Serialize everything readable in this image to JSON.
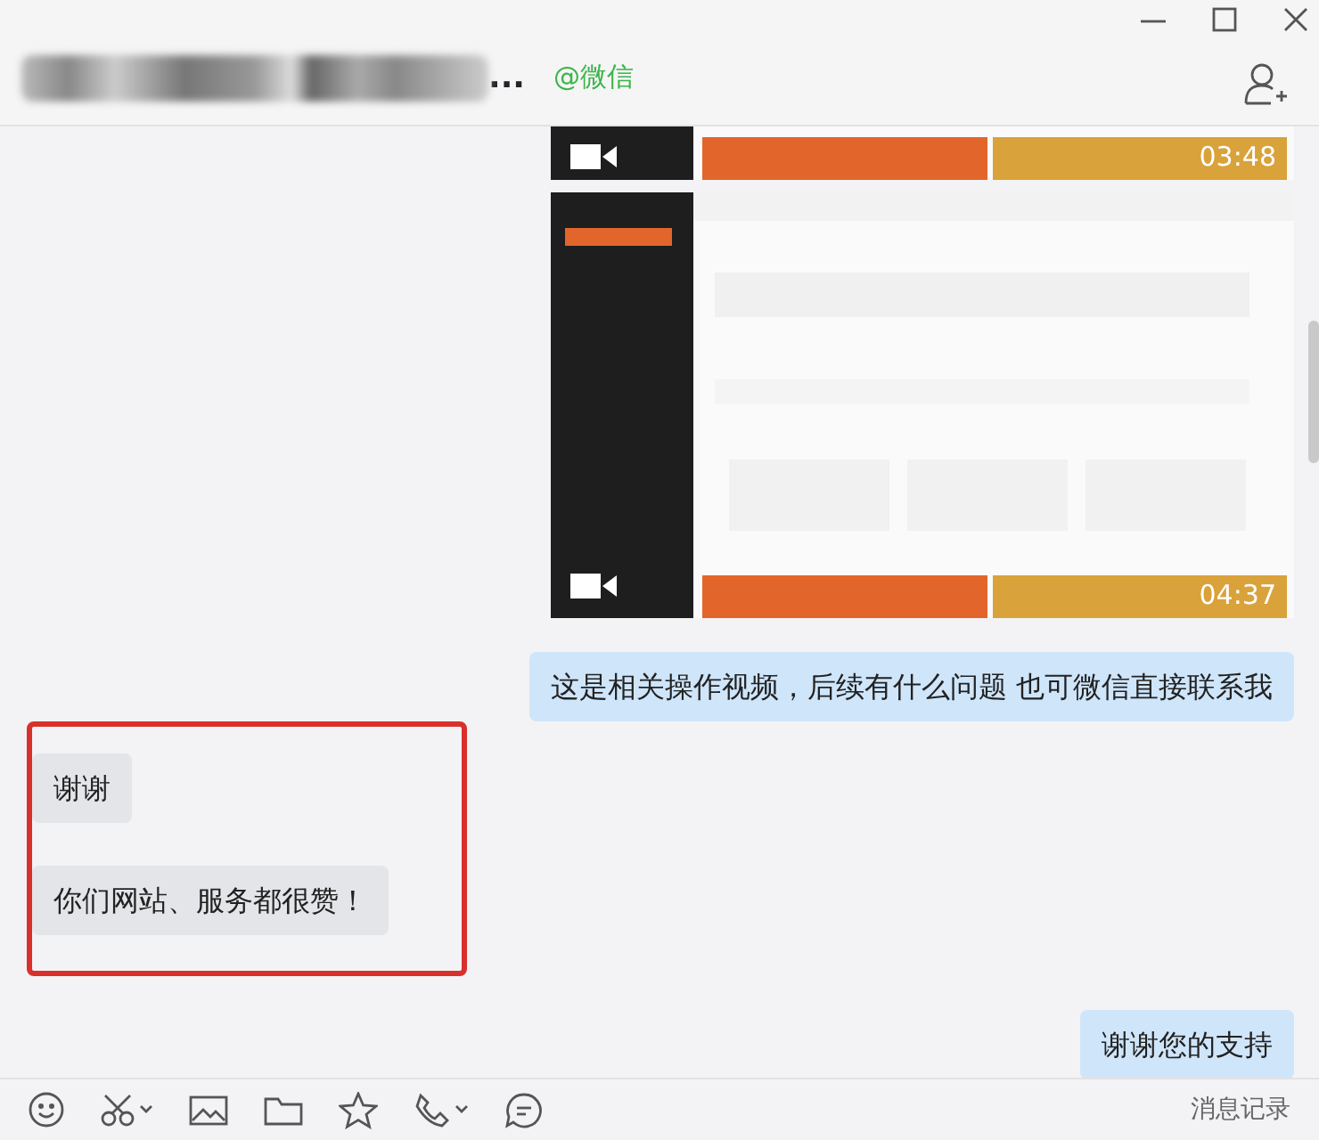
{
  "header": {
    "title_tail": "...",
    "subtitle": "@微信"
  },
  "messages": [
    {
      "kind": "video",
      "outgoing": true,
      "cropped": true,
      "duration": "03:48",
      "highlighted": false
    },
    {
      "kind": "video",
      "outgoing": true,
      "cropped": false,
      "duration": "04:37",
      "highlighted": false
    },
    {
      "kind": "text",
      "outgoing": true,
      "text": "这是相关操作视频，后续有什么问题 也可微信直接联系我",
      "highlighted": false
    },
    {
      "kind": "text",
      "outgoing": false,
      "text": "谢谢",
      "highlighted": true
    },
    {
      "kind": "text",
      "outgoing": false,
      "text": "你们网站、服务都很赞！",
      "highlighted": true
    },
    {
      "kind": "text",
      "outgoing": true,
      "text": "谢谢您的支持",
      "highlighted": false
    }
  ],
  "toolbar": {
    "history_link": "消息记录"
  }
}
